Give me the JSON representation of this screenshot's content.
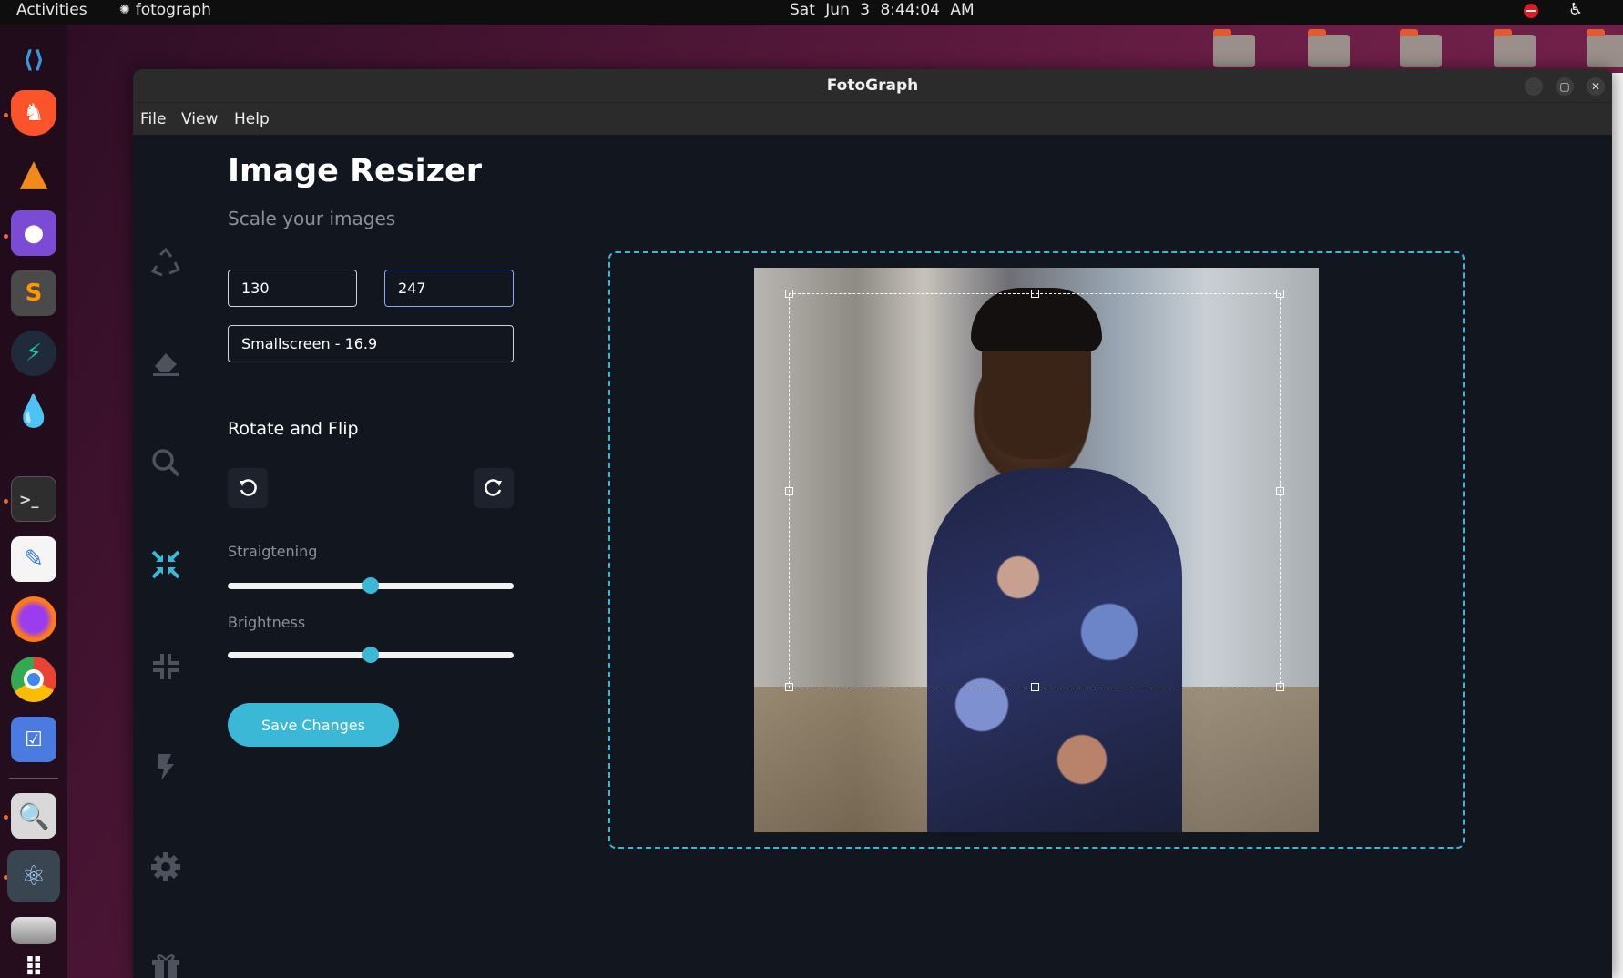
{
  "topbar": {
    "activities": "Activities",
    "app_name": "fotograph",
    "clock": "Sat Jun 3   8:44:04 AM"
  },
  "dock": {
    "items": [
      "vscode-icon",
      "brave-icon",
      "vlc-icon",
      "github-desktop-icon",
      "sublime-text-icon",
      "postman-icon",
      "water-icon",
      "terminal-icon",
      "text-editor-icon",
      "firefox-icon",
      "chrome-icon",
      "tasks-icon",
      "image-viewer-icon",
      "fotograph-icon",
      "drive-icon",
      "app-grid-icon"
    ]
  },
  "window": {
    "title": "FotoGraph",
    "menu": [
      "File",
      "View",
      "Help"
    ]
  },
  "sidebar": {
    "icons": [
      "recycle-icon",
      "eraser-icon",
      "search-icon",
      "compress-arrows-icon",
      "compress-icon",
      "bolt-icon",
      "gear-icon",
      "gift-icon"
    ],
    "active": "compress-arrows-icon",
    "active_color": "#3ab8d6"
  },
  "editor": {
    "title": "Image Resizer",
    "subtitle": "Scale your images",
    "width_value": "130",
    "height_value": "247",
    "preset_value": "Smallscreen - 16.9",
    "rotate_section": "Rotate and Flip",
    "straightening_label": "Straigtening",
    "straightening_value": 0.5,
    "brightness_label": "Brightness",
    "brightness_value": 0.5,
    "save_label": "Save Changes",
    "accent_color": "#3ab8d6"
  }
}
